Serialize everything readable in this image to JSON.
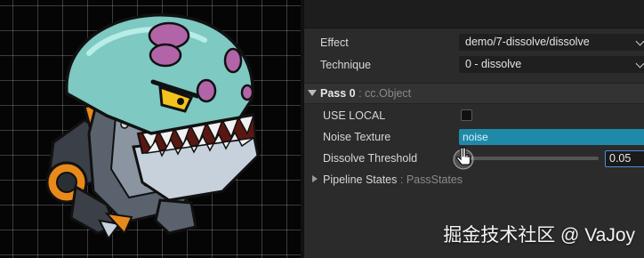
{
  "inspector": {
    "effect": {
      "label": "Effect",
      "value": "demo/7-dissolve/dissolve"
    },
    "technique": {
      "label": "Technique",
      "value": "0 - dissolve"
    },
    "pass": {
      "title": "Pass 0",
      "subtitle": ": cc.Object"
    },
    "use_local": {
      "label": "USE LOCAL",
      "checked": false
    },
    "noise_texture": {
      "label": "Noise Texture",
      "value": "noise"
    },
    "dissolve_threshold": {
      "label": "Dissolve Threshold",
      "value": "0.05",
      "slider_fraction": 0.05
    },
    "pipeline_states": {
      "label": "Pipeline States",
      "subtitle": ": PassStates"
    }
  },
  "watermark": "掘金技术社区 @ VaJoy",
  "colors": {
    "panel_bg": "#2b2b2b",
    "asset_field": "#1f8aa8",
    "focus_border": "#4a8fd8",
    "creature_head": "#7ec9c2",
    "creature_spots": "#b165a8",
    "creature_armor": "#e88a1a"
  },
  "icons": [
    "dropdown-caret-icon",
    "expand-triangle-icon",
    "collapse-triangle-icon",
    "hand-pointer-icon"
  ]
}
